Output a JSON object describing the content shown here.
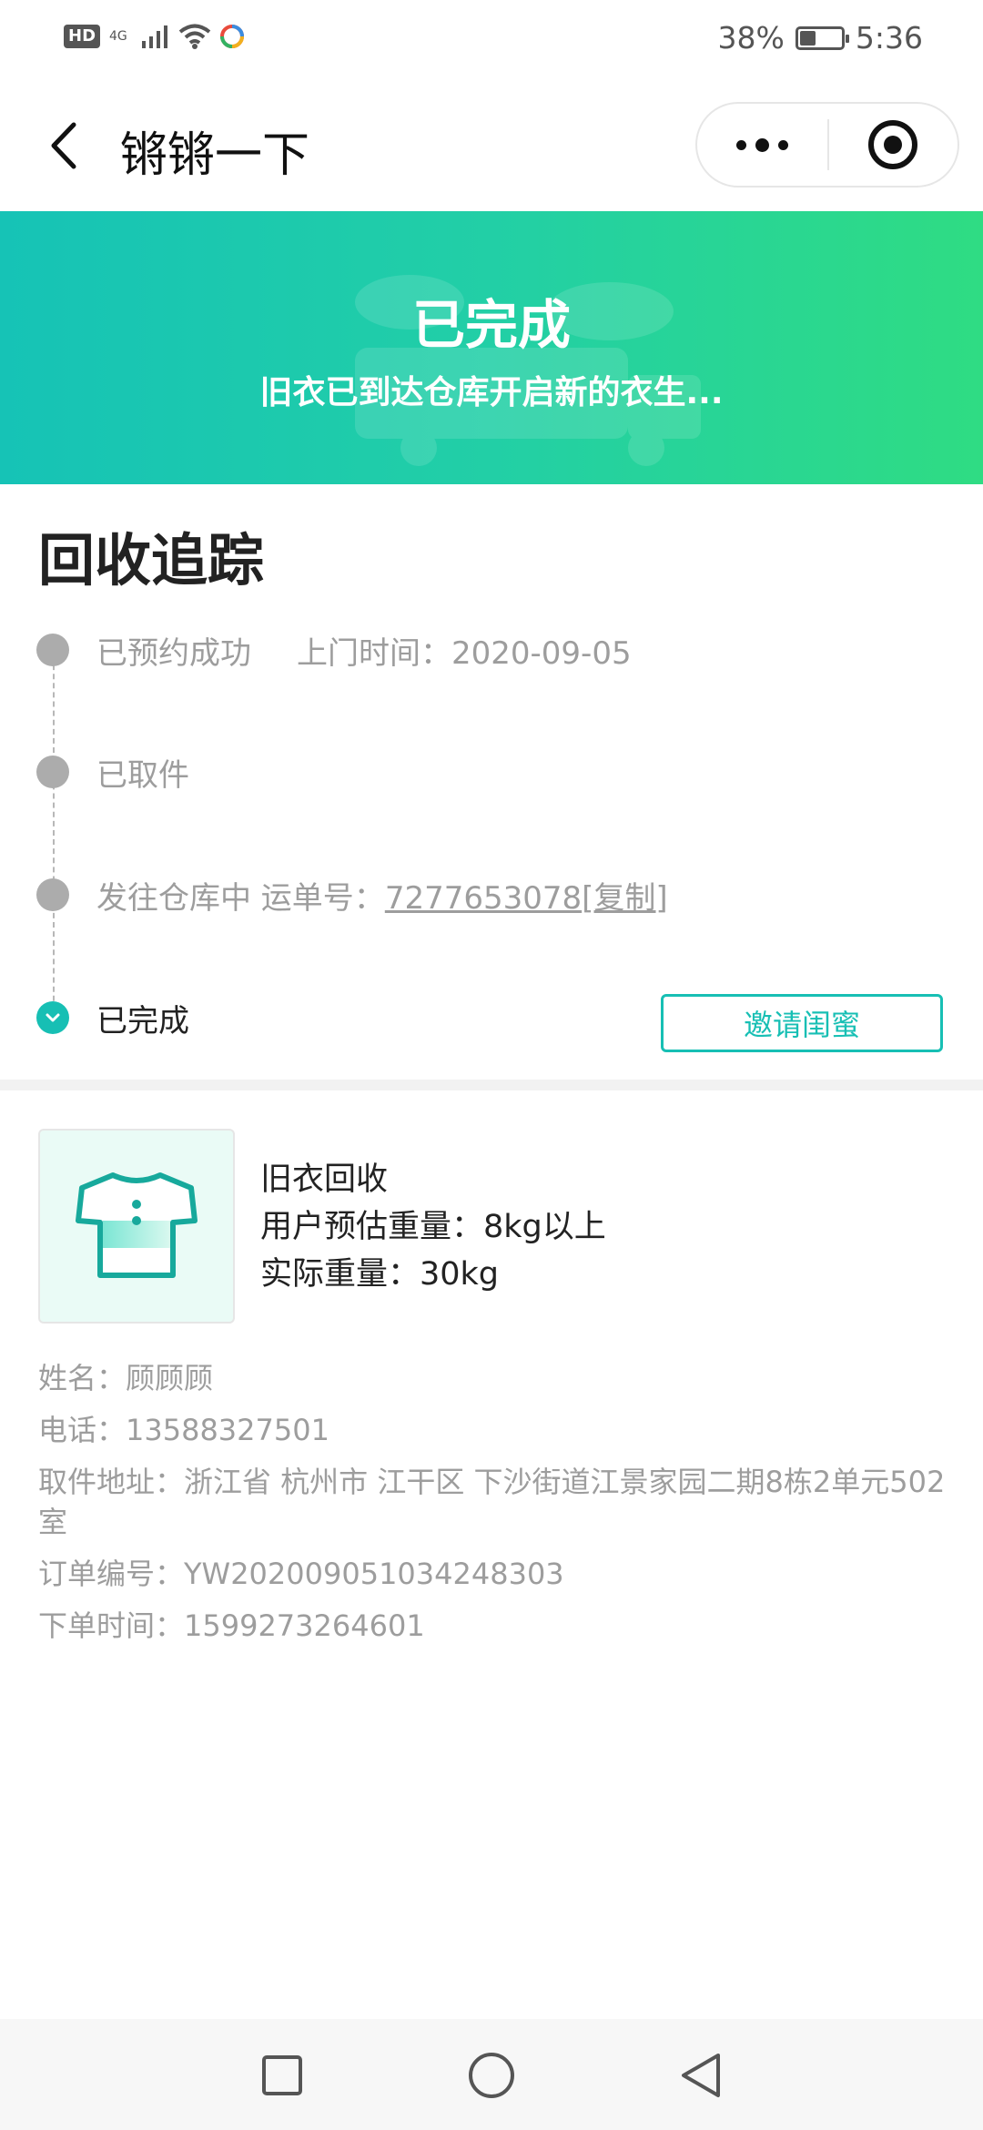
{
  "status_bar": {
    "hd": "HD",
    "network": "4G",
    "battery": "38%",
    "battery_level": 0.38,
    "time": "5:36"
  },
  "header": {
    "title": "锵锵一下"
  },
  "banner": {
    "title": "已完成",
    "subtitle": "旧衣已到达仓库开启新的衣生..."
  },
  "tracking": {
    "title": "回收追踪",
    "steps": [
      {
        "label": "已预约成功",
        "extra": "上门时间：2020-09-05"
      },
      {
        "label": "已取件"
      },
      {
        "label": "发往仓库中 运单号：",
        "tracking_no": "7277653078",
        "copy": "[复制]"
      },
      {
        "label": "已完成"
      }
    ],
    "invite_button": "邀请闺蜜"
  },
  "product": {
    "name": "旧衣回收",
    "estimated_weight": "用户预估重量：8kg以上",
    "actual_weight": "实际重量：30kg"
  },
  "details": {
    "name": "姓名：顾顾顾",
    "phone": "电话：13588327501",
    "address": "取件地址：浙江省 杭州市 江干区 下沙街道江景家园二期8栋2单元502室",
    "order_no": "订单编号：YW202009051034248303",
    "order_time": "下单时间：1599273264601"
  },
  "colors": {
    "accent": "#17bfb4",
    "banner_start": "#16c3b6",
    "banner_end": "#2fdc83",
    "muted": "#9d9d9d"
  },
  "icons": {
    "back": "chevron-left-icon",
    "more": "more-dots-icon",
    "close": "target-circle-icon",
    "product": "tshirt-icon",
    "nav_recent": "square-icon",
    "nav_home": "circle-icon",
    "nav_back": "triangle-back-icon"
  }
}
